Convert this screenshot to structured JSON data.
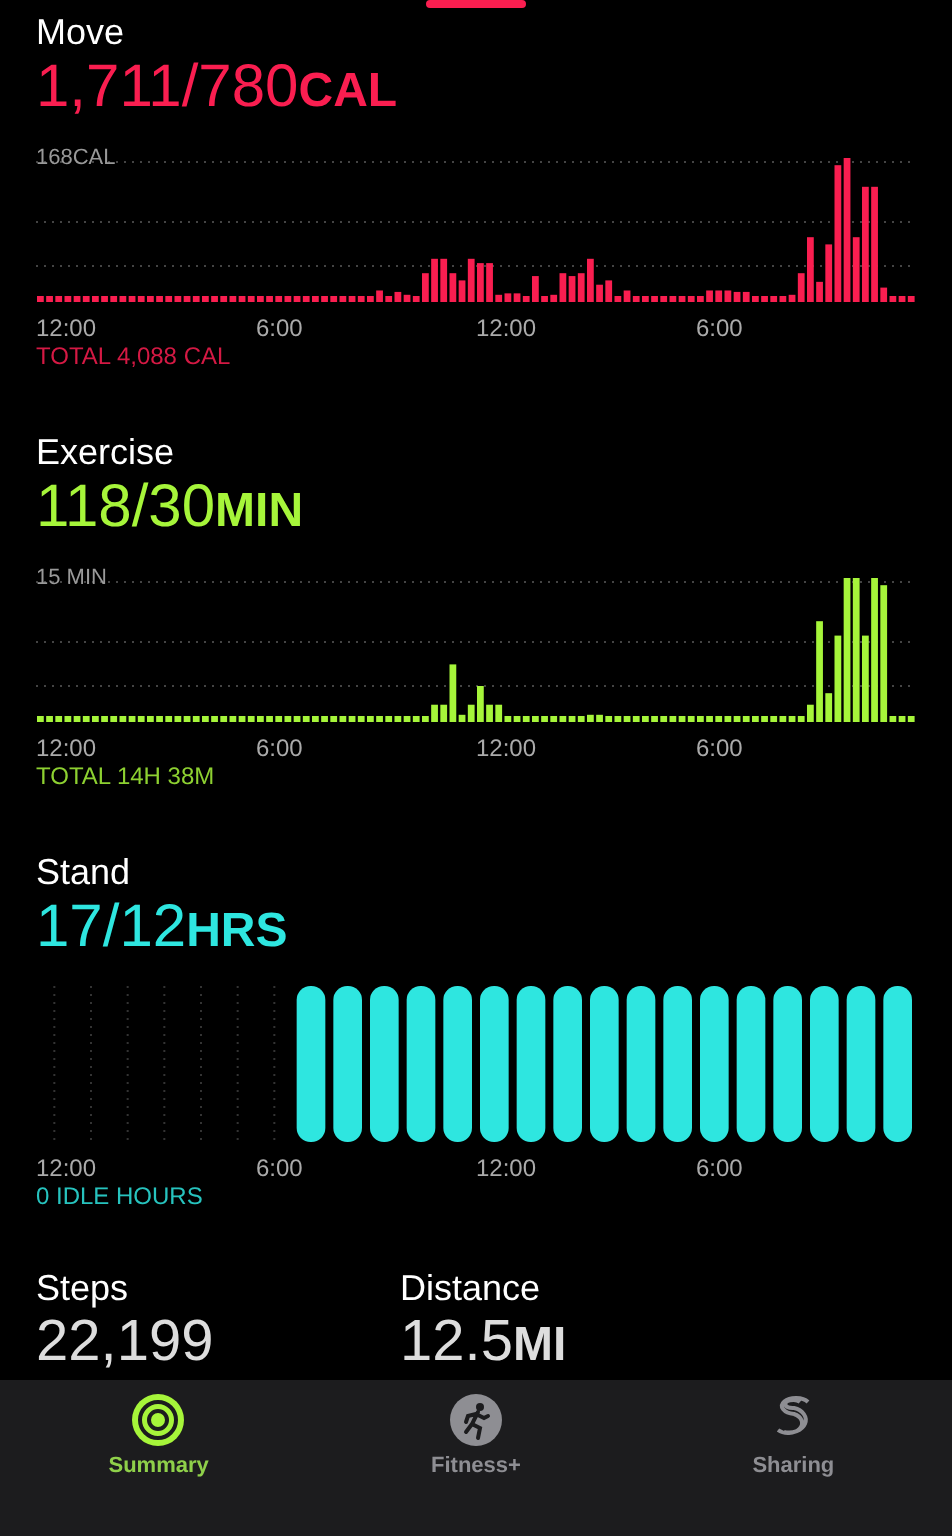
{
  "sections": [
    {
      "kind": "bars",
      "title": "Move",
      "value": "1,711/780",
      "unit": "CAL",
      "color": "#fa1e50",
      "top_label": "168CAL",
      "x_labels": [
        "12:00",
        "6:00",
        "12:00",
        "6:00"
      ],
      "footer": "TOTAL 4,088 CAL"
    },
    {
      "kind": "bars",
      "title": "Exercise",
      "value": "118/30",
      "unit": "MIN",
      "color": "#a6f53a",
      "top_label": "15 MIN",
      "x_labels": [
        "12:00",
        "6:00",
        "12:00",
        "6:00"
      ],
      "footer": "TOTAL 14H 38M"
    },
    {
      "kind": "stand",
      "title": "Stand",
      "value": "17/12",
      "unit": "HRS",
      "color": "#2ee6e0",
      "x_labels": [
        "12:00",
        "6:00",
        "12:00",
        "6:00"
      ],
      "footer": "0 IDLE HOURS"
    }
  ],
  "stats": [
    {
      "label": "Steps",
      "value": "22,199"
    },
    {
      "label": "Distance",
      "value": "12.5",
      "unit": "MI"
    }
  ],
  "tabs": [
    {
      "label": "Summary",
      "kind": "rings",
      "selected": true
    },
    {
      "label": "Fitness+",
      "kind": "runner",
      "selected": false
    },
    {
      "label": "Sharing",
      "kind": "sharing",
      "selected": false
    }
  ]
}
